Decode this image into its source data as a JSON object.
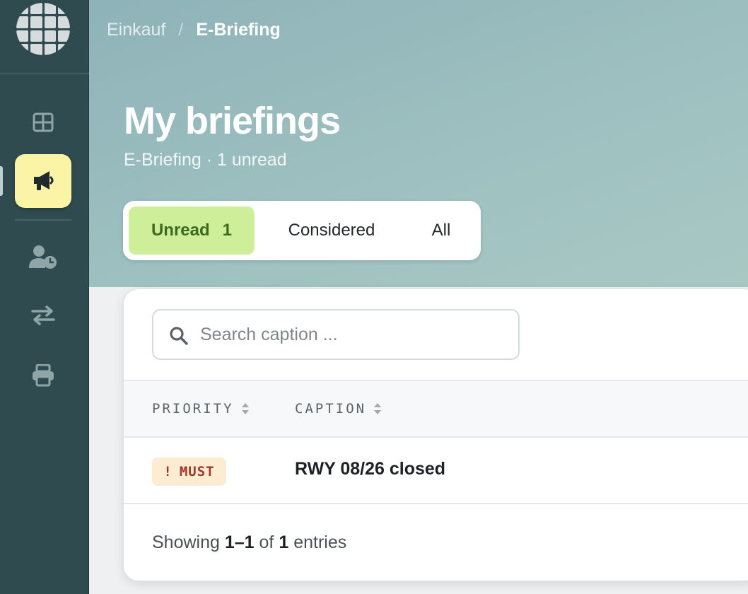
{
  "breadcrumb": {
    "parent": "Einkauf",
    "separator": "/",
    "current": "E-Briefing"
  },
  "page": {
    "title": "My briefings",
    "subtitle": "E-Briefing · 1 unread"
  },
  "tabs": [
    {
      "label": "Unread",
      "count": "1",
      "active": true
    },
    {
      "label": "Considered"
    },
    {
      "label": "All"
    }
  ],
  "search": {
    "placeholder": "Search caption ...",
    "value": ""
  },
  "table": {
    "columns": [
      "PRIORITY",
      "CAPTION"
    ],
    "rows": [
      {
        "priority_icon": "!",
        "priority": "MUST",
        "caption": "RWY 08/26 closed"
      }
    ]
  },
  "footer": {
    "prefix": "Showing",
    "range": "1–1",
    "of": "of",
    "total": "1",
    "suffix": "entries"
  },
  "sidebar": {
    "items": [
      {
        "icon": "grid-icon",
        "active": false
      },
      {
        "icon": "megaphone-icon",
        "active": true
      },
      {
        "icon": "user-clock-icon",
        "active": false
      },
      {
        "icon": "transfer-arrows-icon",
        "active": false
      },
      {
        "icon": "printer-icon",
        "active": false
      }
    ]
  },
  "colors": {
    "sidebar": "#2f4b4f",
    "active_nav": "#fbf3a6",
    "active_tab": "#cfee9a",
    "priority_badge_bg": "#fbecd2",
    "priority_badge_text": "#a1372c"
  }
}
